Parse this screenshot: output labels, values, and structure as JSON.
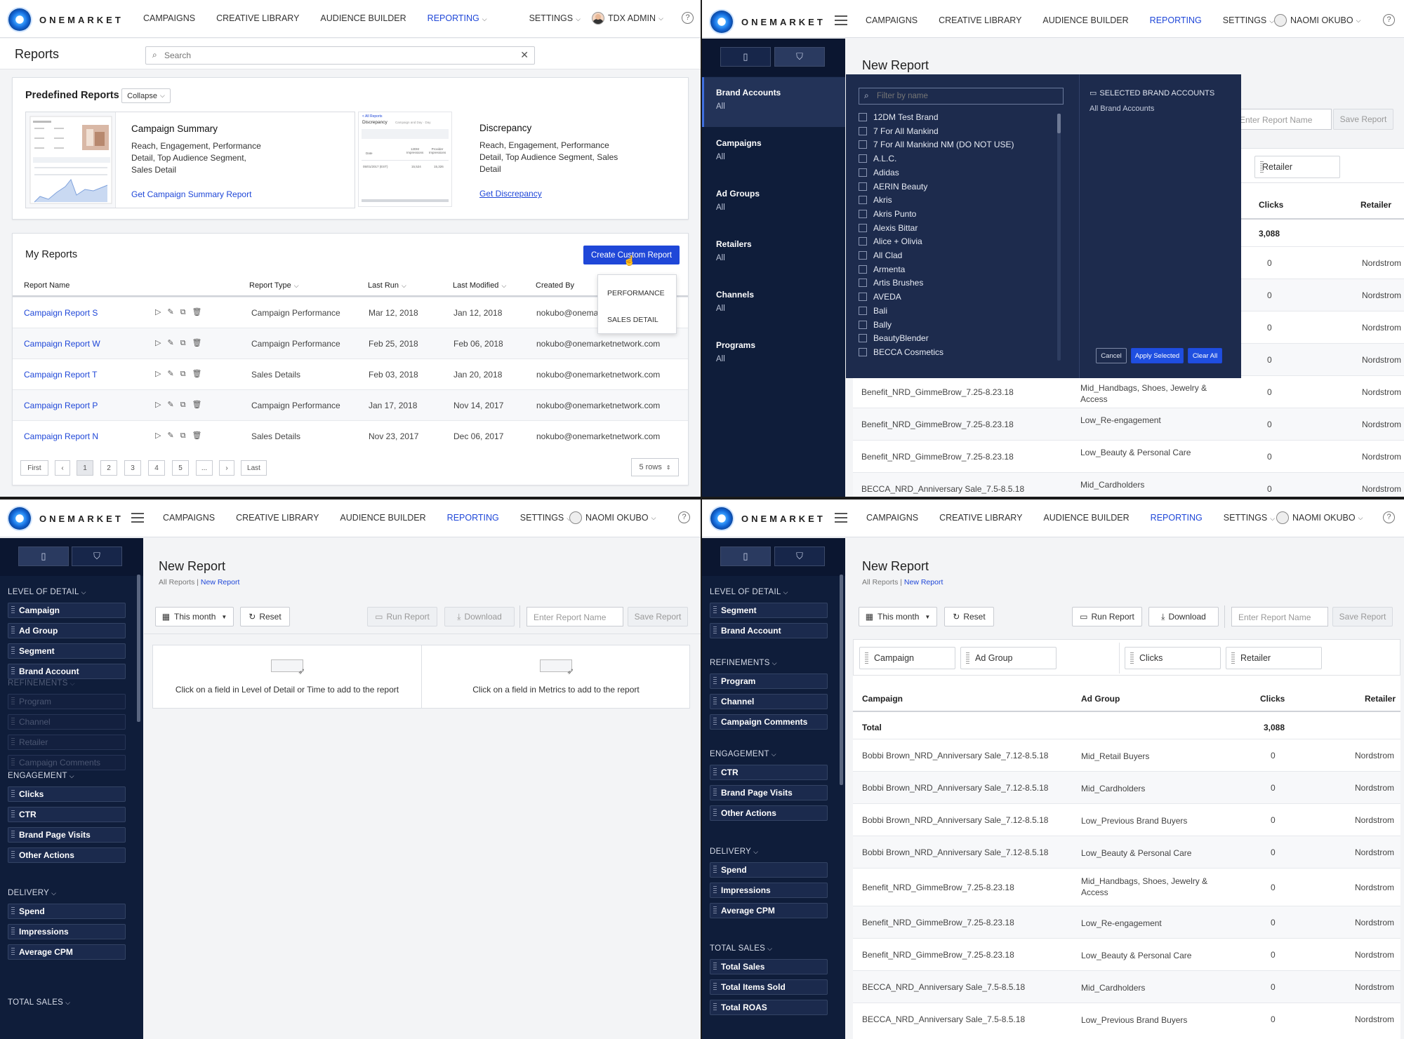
{
  "brand": {
    "name": "ONEMARKET"
  },
  "nav": {
    "campaigns": "CAMPAIGNS",
    "creative_library": "CREATIVE LIBRARY",
    "audience_builder": "AUDIENCE BUILDER",
    "reporting": "REPORTING",
    "settings": "SETTINGS"
  },
  "users": {
    "admin": "TDX ADMIN",
    "naomi": "NAOMI OKUBO"
  },
  "help_label": "?",
  "p1": {
    "title": "Reports",
    "search_placeholder": "Search",
    "predefined_title": "Predefined Reports",
    "collapse_label": "Collapse",
    "campaign_summary": {
      "title": "Campaign Summary",
      "desc": "Reach, Engagement, Performance Detail, Top Audience Segment, Sales Detail",
      "link": "Get Campaign Summary Report"
    },
    "discrepancy": {
      "title": "Discrepancy",
      "desc": "Reach, Engagement, Performance Detail, Top Audience Segment, Sales Detail",
      "link": "Get Discrepancy"
    },
    "thumb_discrepancy": {
      "crumb": "< All Reports",
      "title": "Discrepancy",
      "opt1": "Campaign and Day",
      "opt2": "Day",
      "col1": "Date",
      "col2": "12DM Impressions",
      "col3": "Provider Impressions",
      "row_date": "05/01/2017 (EST)",
      "row_v1": "15,524",
      "row_v2": "15,326"
    },
    "my_reports_title": "My Reports",
    "create_label": "Create Custom Report",
    "dropdown": [
      "PERFORMANCE",
      "SALES DETAIL"
    ],
    "columns": {
      "name": "Report Name",
      "type": "Report Type",
      "last_run": "Last Run",
      "last_modified": "Last Modified",
      "created_by": "Created By"
    },
    "rows": [
      {
        "name": "Campaign Report S",
        "type": "Campaign Performance",
        "last_run": "Mar 12, 2018",
        "last_modified": "Jan 12, 2018",
        "created_by": "nokubo@onemar"
      },
      {
        "name": "Campaign Report W",
        "type": "Campaign Performance",
        "last_run": "Feb 25, 2018",
        "last_modified": "Feb 06, 2018",
        "created_by": "nokubo@onemarketnetwork.com"
      },
      {
        "name": "Campaign Report T",
        "type": "Sales Details",
        "last_run": "Feb 03, 2018",
        "last_modified": "Jan 20, 2018",
        "created_by": "nokubo@onemarketnetwork.com"
      },
      {
        "name": "Campaign Report P",
        "type": "Campaign Performance",
        "last_run": "Jan 17, 2018",
        "last_modified": "Nov 14, 2017",
        "created_by": "nokubo@onemarketnetwork.com"
      },
      {
        "name": "Campaign Report N",
        "type": "Sales Details",
        "last_run": "Nov 23, 2017",
        "last_modified": "Dec 06, 2017",
        "created_by": "nokubo@onemarketnetwork.com"
      }
    ],
    "pagination": {
      "first": "First",
      "prev": "‹",
      "pages": [
        "1",
        "2",
        "3",
        "4",
        "5",
        "..."
      ],
      "next": "›",
      "last": "Last",
      "rows": "5 rows"
    }
  },
  "p2": {
    "title": "New Report",
    "filters": [
      {
        "label": "Brand Accounts",
        "value": "All"
      },
      {
        "label": "Campaigns",
        "value": "All"
      },
      {
        "label": "Ad Groups",
        "value": "All"
      },
      {
        "label": "Retailers",
        "value": "All"
      },
      {
        "label": "Channels",
        "value": "All"
      },
      {
        "label": "Programs",
        "value": "All"
      }
    ],
    "filter_placeholder": "Filter by name",
    "brands": [
      "12DM Test Brand",
      "7 For All Mankind",
      "7 For All Mankind NM (DO NOT USE)",
      "A.L.C.",
      "Adidas",
      "AERIN Beauty",
      "Akris",
      "Akris Punto",
      "Alexis Bittar",
      "Alice + Olivia",
      "All Clad",
      "Armenta",
      "Artis Brushes",
      "AVEDA",
      "Bali",
      "Bally",
      "BeautyBlender",
      "BECCA Cosmetics"
    ],
    "selected_title": "SELECTED BRAND ACCOUNTS",
    "selected_value": "All Brand Accounts",
    "cancel": "Cancel",
    "apply": "Apply Selected",
    "clear": "Clear All",
    "report_name_placeholder": "Enter Report Name",
    "save_label": "Save Report",
    "chip_retailer": "Retailer",
    "header_clicks": "Clicks",
    "header_retailer": "Retailer",
    "total_value": "3,088",
    "rows": [
      {
        "campaign": "",
        "adgroup": "",
        "clicks": "0",
        "retailer": "Nordstrom"
      },
      {
        "campaign": "",
        "adgroup": "",
        "clicks": "0",
        "retailer": "Nordstrom"
      },
      {
        "campaign": "",
        "adgroup": "",
        "clicks": "0",
        "retailer": "Nordstrom"
      },
      {
        "campaign": "",
        "adgroup": "",
        "clicks": "0",
        "retailer": "Nordstrom"
      },
      {
        "campaign": "Benefit_NRD_GimmeBrow_7.25-8.23.18",
        "adgroup": "Mid_Handbags, Shoes, Jewelry & Access",
        "clicks": "0",
        "retailer": "Nordstrom"
      },
      {
        "campaign": "Benefit_NRD_GimmeBrow_7.25-8.23.18",
        "adgroup": "Low_Re-engagement",
        "clicks": "0",
        "retailer": "Nordstrom"
      },
      {
        "campaign": "Benefit_NRD_GimmeBrow_7.25-8.23.18",
        "adgroup": "Low_Beauty & Personal Care",
        "clicks": "0",
        "retailer": "Nordstrom"
      },
      {
        "campaign": "BECCA_NRD_Anniversary Sale_7.5-8.5.18",
        "adgroup": "Mid_Cardholders",
        "clicks": "0",
        "retailer": "Nordstrom"
      }
    ]
  },
  "p3": {
    "title": "New Report",
    "crumb_root": "All Reports",
    "crumb_current": "New Report",
    "date_label": "This month",
    "reset_label": "Reset",
    "run_label": "Run Report",
    "download_label": "Download",
    "name_placeholder": "Enter Report Name",
    "save_label": "Save Report",
    "hint_left": "Click on a field in Level of Detail or Time to add to the report",
    "hint_right": "Click on a field in Metrics to add to the report",
    "sections": {
      "level": {
        "title": "LEVEL OF DETAIL",
        "items": [
          "Campaign",
          "Ad Group",
          "Segment",
          "Brand Account"
        ]
      },
      "refinements": {
        "title": "REFINEMENTS",
        "items": [
          "Program",
          "Channel",
          "Retailer",
          "Campaign Comments"
        ]
      },
      "engagement": {
        "title": "ENGAGEMENT",
        "items": [
          "Clicks",
          "CTR",
          "Brand Page Visits",
          "Other Actions"
        ]
      },
      "delivery": {
        "title": "DELIVERY",
        "items": [
          "Spend",
          "Impressions",
          "Average CPM"
        ]
      },
      "total_sales": {
        "title": "TOTAL SALES"
      }
    }
  },
  "p4": {
    "title": "New Report",
    "crumb_root": "All Reports",
    "crumb_current": "New Report",
    "date_label": "This month",
    "reset_label": "Reset",
    "run_label": "Run Report",
    "download_label": "Download",
    "name_placeholder": "Enter Report Name",
    "save_label": "Save Report",
    "sections": {
      "level": {
        "title": "LEVEL OF DETAIL",
        "items": [
          "Segment",
          "Brand Account"
        ]
      },
      "refinements": {
        "title": "REFINEMENTS",
        "items": [
          "Program",
          "Channel",
          "Campaign Comments"
        ]
      },
      "engagement": {
        "title": "ENGAGEMENT",
        "items": [
          "CTR",
          "Brand Page Visits",
          "Other Actions"
        ]
      },
      "delivery": {
        "title": "DELIVERY",
        "items": [
          "Spend",
          "Impressions",
          "Average CPM"
        ]
      },
      "total_sales": {
        "title": "TOTAL SALES",
        "items": [
          "Total Sales",
          "Total Items Sold",
          "Total ROAS"
        ]
      }
    },
    "chips": [
      "Campaign",
      "Ad Group",
      "Clicks",
      "Retailer"
    ],
    "headers": {
      "campaign": "Campaign",
      "adgroup": "Ad Group",
      "clicks": "Clicks",
      "retailer": "Retailer"
    },
    "total": {
      "label": "Total",
      "clicks": "3,088"
    },
    "rows": [
      {
        "campaign": "Bobbi Brown_NRD_Anniversary Sale_7.12-8.5.18",
        "adgroup": "Mid_Retail Buyers",
        "clicks": "0",
        "retailer": "Nordstrom"
      },
      {
        "campaign": "Bobbi Brown_NRD_Anniversary Sale_7.12-8.5.18",
        "adgroup": "Mid_Cardholders",
        "clicks": "0",
        "retailer": "Nordstrom"
      },
      {
        "campaign": "Bobbi Brown_NRD_Anniversary Sale_7.12-8.5.18",
        "adgroup": "Low_Previous Brand Buyers",
        "clicks": "0",
        "retailer": "Nordstrom"
      },
      {
        "campaign": "Bobbi Brown_NRD_Anniversary Sale_7.12-8.5.18",
        "adgroup": "Low_Beauty & Personal Care",
        "clicks": "0",
        "retailer": "Nordstrom"
      },
      {
        "campaign": "Benefit_NRD_GimmeBrow_7.25-8.23.18",
        "adgroup": "Mid_Handbags, Shoes, Jewelry & Access",
        "clicks": "0",
        "retailer": "Nordstrom"
      },
      {
        "campaign": "Benefit_NRD_GimmeBrow_7.25-8.23.18",
        "adgroup": "Low_Re-engagement",
        "clicks": "0",
        "retailer": "Nordstrom"
      },
      {
        "campaign": "Benefit_NRD_GimmeBrow_7.25-8.23.18",
        "adgroup": "Low_Beauty & Personal Care",
        "clicks": "0",
        "retailer": "Nordstrom"
      },
      {
        "campaign": "BECCA_NRD_Anniversary Sale_7.5-8.5.18",
        "adgroup": "Mid_Cardholders",
        "clicks": "0",
        "retailer": "Nordstrom"
      },
      {
        "campaign": "BECCA_NRD_Anniversary Sale_7.5-8.5.18",
        "adgroup": "Low_Previous Brand Buyers",
        "clicks": "0",
        "retailer": "Nordstrom"
      }
    ]
  }
}
